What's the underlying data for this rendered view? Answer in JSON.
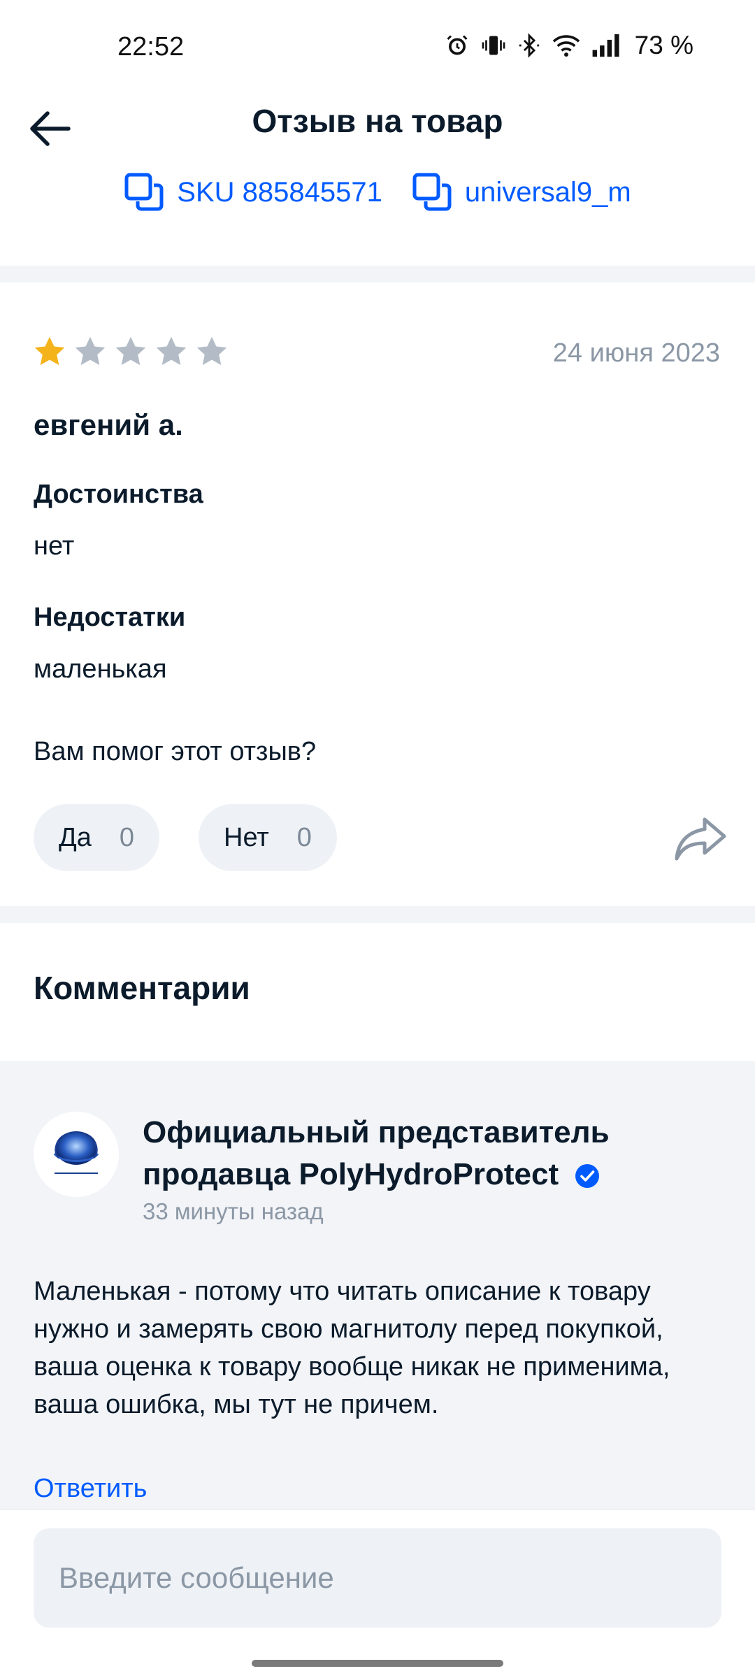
{
  "status_bar": {
    "time": "22:52",
    "battery": "73 %",
    "icons": [
      "alarm-icon",
      "vibrate-icon",
      "bluetooth-icon",
      "wifi-icon",
      "signal-icon"
    ]
  },
  "header": {
    "title": "Отзыв на товар",
    "back_icon": "arrow-left-icon"
  },
  "product": {
    "sku_label": "SKU 885845571",
    "seller_label": "universal9_m",
    "copy_icon": "copy-icon"
  },
  "review": {
    "rating": 1,
    "rating_max": 5,
    "date": "24 июня 2023",
    "author": "евгений а.",
    "pros_title": "Достоинства",
    "pros_text": "нет",
    "cons_title": "Недостатки",
    "cons_text": "маленькая",
    "helpful_question": "Вам помог этот отзыв?",
    "yes_label": "Да",
    "yes_count": "0",
    "no_label": "Нет",
    "no_count": "0",
    "share_icon": "share-icon"
  },
  "comments": {
    "title": "Комментарии",
    "items": [
      {
        "author_line1": "Официальный представитель",
        "author_line2": "продавца PolyHydroProtect",
        "time": "33 минуты назад",
        "text": "Маленькая - потому что читать описание к товару нужно и замерять свою магнитолу перед покупкой, ваша оценка к товару вообще никак не применима, ваша ошибка, мы тут не причем.",
        "reply_label": "Ответить"
      }
    ]
  },
  "composer": {
    "placeholder": "Введите сообщение"
  },
  "colors": {
    "accent": "#005bff",
    "star_active": "#f5b31b",
    "star_inactive": "#b3bcc6",
    "muted": "#8b97a5",
    "surface": "#f2f4f7"
  }
}
